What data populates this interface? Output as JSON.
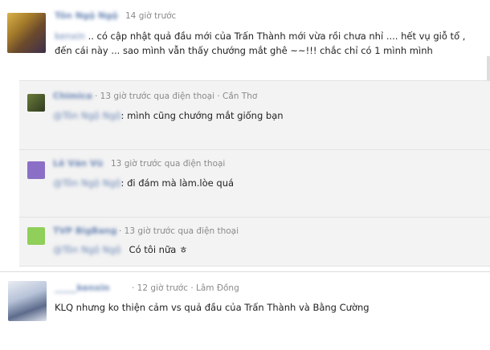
{
  "post": {
    "author": "Tôn Ngộ Ngộ",
    "time": "14 giờ trước",
    "mention": "kenxin",
    "text": ".. có cập nhật quả đầu mới của Trấn Thành mới vừa rồi chưa nhỉ .... hết vụ giỗ tổ , đến cái này ... sao mình vẫn thấy chướng mắt ghê ~~!!! chắc chỉ có 1 mình mình"
  },
  "replies": [
    {
      "author": "Chimica",
      "meta": "· 13 giờ trước qua điện thoại · Cần Thơ",
      "mention": "@Tôn Ngộ Ngộ",
      "text": ": mình cũng chướng mắt giống bạn"
    },
    {
      "author": "Lê Văn Vũ",
      "meta": "13 giờ trước qua điện thoại",
      "mention": "@Tôn Ngộ Ngộ",
      "text": ": đi đám mà làm.lòe quá"
    },
    {
      "author": "TVP BigBang",
      "meta": "· 13 giờ trước qua điện thoại",
      "mention": "@Tôn Ngộ Ngộ",
      "text": "Có tôi nữa ㅎ"
    }
  ],
  "post2": {
    "author": "_____kenxin",
    "meta": "· 12 giờ trước · Lâm Đồng",
    "text": "KLQ nhưng ko thiện cảm vs quả đầu của Trấn Thành và Bằng Cường"
  }
}
